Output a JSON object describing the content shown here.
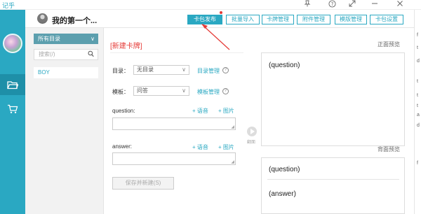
{
  "window": {
    "app_name": "记乎"
  },
  "header": {
    "title": "我的第一个...",
    "buttons": {
      "publish": "卡包发布",
      "batch_import": "批量导入",
      "card_manage": "卡牌管理",
      "attach_manage": "附件管理",
      "template_manage": "模版管理",
      "settings": "卡包设置"
    }
  },
  "sidebar": {
    "icons": [
      "folder-icon",
      "cart-icon"
    ]
  },
  "directory": {
    "select_label": "所有目录",
    "search_placeholder": "搜索(/)",
    "items": [
      {
        "label": "BOY"
      }
    ]
  },
  "editor": {
    "heading": "[新建卡牌]",
    "dir_label": "目录：",
    "dir_value": "无目录",
    "dir_link": "目录管理",
    "template_label": "模板：",
    "template_value": "问答",
    "template_link": "模板管理",
    "fields": [
      {
        "label": "question:",
        "voice": "+ 语音",
        "image": "+ 图片"
      },
      {
        "label": "answer:",
        "voice": "+ 语音",
        "image": "+ 图片"
      }
    ],
    "save_button": "保存并新建(S)"
  },
  "preview": {
    "front_label": "正面预览",
    "back_label": "背面预览",
    "flip_label": "翻面",
    "front_text": "(question)",
    "back_question": "(question)",
    "back_answer": "(answer)"
  },
  "edge_chars": [
    "f",
    "t",
    "d",
    "t",
    "t",
    "t",
    "a",
    "d",
    "f"
  ],
  "colors": {
    "accent": "#2aa8c2",
    "highlight": "#e53935"
  }
}
